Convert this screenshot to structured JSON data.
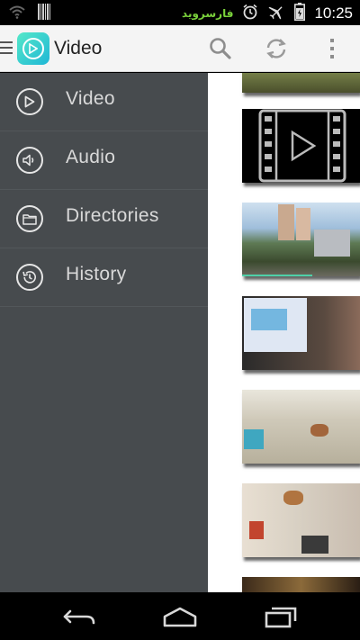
{
  "status_bar": {
    "time": "10:25",
    "watermark": "فارسروید",
    "icons": [
      "wifi-icon",
      "barcode-icon",
      "alarm-icon",
      "airplane-mode-icon",
      "battery-icon"
    ]
  },
  "action_bar": {
    "title": "Video",
    "icons": [
      "menu-icon",
      "search-icon",
      "refresh-icon",
      "overflow-menu-icon"
    ]
  },
  "drawer": {
    "items": [
      {
        "label": "Video",
        "icon": "play-circle-icon"
      },
      {
        "label": "Audio",
        "icon": "speaker-icon"
      },
      {
        "label": "Directories",
        "icon": "folder-icon"
      },
      {
        "label": "History",
        "icon": "history-icon"
      }
    ]
  },
  "thumbnails": [
    {
      "kind": "photo-partial"
    },
    {
      "kind": "video-placeholder"
    },
    {
      "kind": "photo"
    },
    {
      "kind": "photo"
    },
    {
      "kind": "photo"
    },
    {
      "kind": "photo"
    },
    {
      "kind": "photo-partial"
    }
  ],
  "nav_bar": {
    "buttons": [
      "back-icon",
      "home-icon",
      "recents-icon"
    ]
  },
  "colors": {
    "drawer_bg": "#474b4e",
    "action_bar_bg": "#f4f4f4",
    "accent": "#1fb7d6"
  }
}
